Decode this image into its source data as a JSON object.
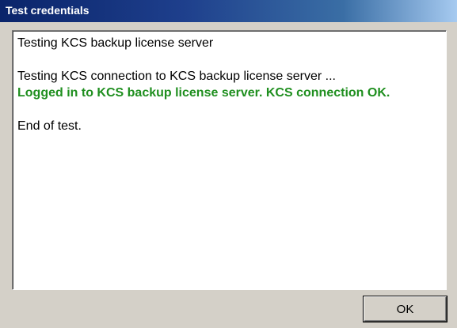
{
  "window": {
    "title": "Test credentials"
  },
  "log": {
    "line1": "Testing KCS backup license server",
    "line2": "Testing KCS connection to KCS backup license server ...",
    "success": "Logged in to KCS backup license server. KCS connection OK.",
    "line_end": "End of test."
  },
  "buttons": {
    "ok_label": "OK"
  },
  "colors": {
    "success_text": "#1f8f1f",
    "titlebar_start": "#0a246a",
    "titlebar_end": "#a6caf0",
    "dialog_bg": "#d4d0c8"
  }
}
